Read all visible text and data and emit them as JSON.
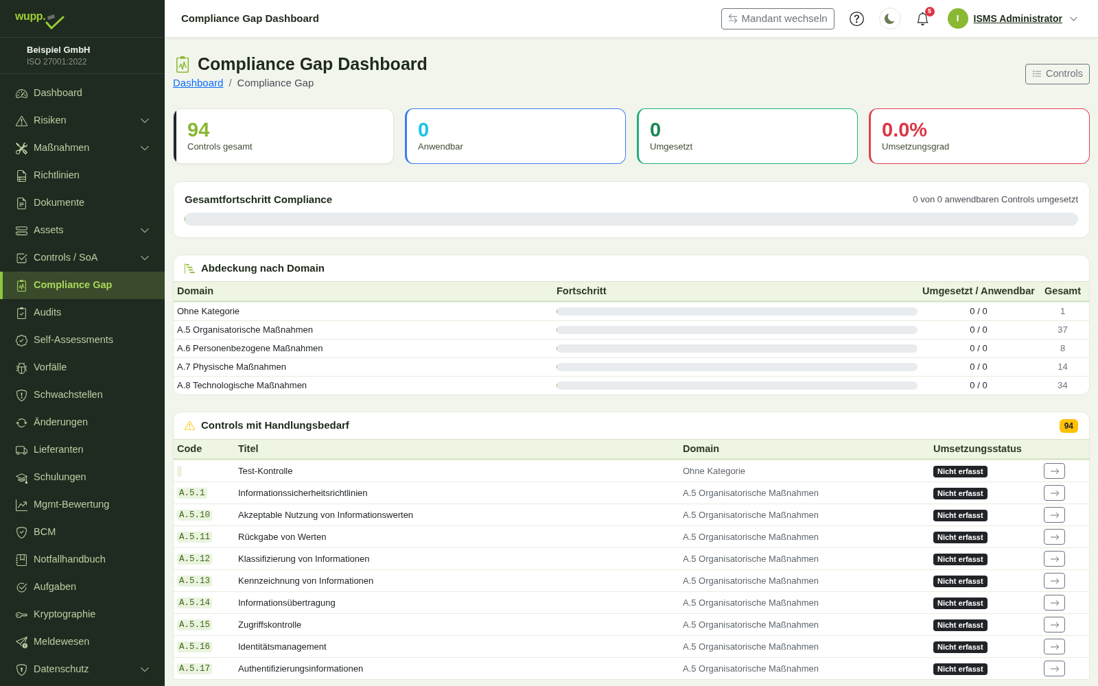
{
  "sidebar": {
    "logo": {
      "text": "wupp."
    },
    "organization": {
      "name": "Beispiel GmbH",
      "standard": "ISO 27001:2022"
    },
    "items": [
      {
        "label": "Dashboard",
        "kind": "link",
        "selected": false
      },
      {
        "label": "Risiken",
        "kind": "group",
        "selected": false,
        "expanded": false
      },
      {
        "label": "Maßnahmen",
        "kind": "group",
        "selected": false,
        "expanded": false
      },
      {
        "label": "Richtlinien",
        "kind": "link",
        "selected": false
      },
      {
        "label": "Dokumente",
        "kind": "link",
        "selected": false
      },
      {
        "label": "Assets",
        "kind": "group",
        "selected": false,
        "expanded": false
      },
      {
        "label": "Controls / SoA",
        "kind": "group",
        "selected": false,
        "expanded": false
      },
      {
        "label": "Compliance Gap",
        "kind": "link",
        "selected": true
      },
      {
        "label": "Audits",
        "kind": "link",
        "selected": false
      },
      {
        "label": "Self-Assessments",
        "kind": "link",
        "selected": false
      },
      {
        "label": "Vorfälle",
        "kind": "link",
        "selected": false
      },
      {
        "label": "Schwachstellen",
        "kind": "link",
        "selected": false
      },
      {
        "label": "Änderungen",
        "kind": "link",
        "selected": false
      },
      {
        "label": "Lieferanten",
        "kind": "link",
        "selected": false
      },
      {
        "label": "Schulungen",
        "kind": "link",
        "selected": false
      },
      {
        "label": "Mgmt-Bewertung",
        "kind": "link",
        "selected": false
      },
      {
        "label": "BCM",
        "kind": "link",
        "selected": false
      },
      {
        "label": "Notfallhandbuch",
        "kind": "link",
        "selected": false
      },
      {
        "label": "Aufgaben",
        "kind": "link",
        "selected": false
      },
      {
        "label": "Kryptographie",
        "kind": "link",
        "selected": false
      },
      {
        "label": "Meldewesen",
        "kind": "link",
        "selected": false
      },
      {
        "label": "Datenschutz",
        "kind": "group",
        "selected": false,
        "expanded": false
      }
    ]
  },
  "header": {
    "title": "Compliance Gap Dashboard",
    "switch_button": "Mandant wechseln",
    "notification_count": "5",
    "user": {
      "initial": "I",
      "name": "ISMS Administrator"
    }
  },
  "page": {
    "title": "Compliance Gap Dashboard",
    "breadcrumb": [
      {
        "label": "Dashboard",
        "current": false
      },
      {
        "label": "Compliance Gap",
        "current": true
      }
    ],
    "breadcrumb_separator": "/",
    "controls_button": "Controls"
  },
  "stats": [
    {
      "value": "94",
      "label": "Controls gesamt",
      "kind": "accent",
      "color": "#8ab833",
      "border": {
        "color": "#212529"
      }
    },
    {
      "value": "0",
      "label": "Anwendbar",
      "kind": "outlined",
      "color": "#19c3e6",
      "border": {
        "color": "#3b7ded"
      }
    },
    {
      "value": "0",
      "label": "Umgesetzt",
      "kind": "outlined",
      "color": "#198754",
      "border": {
        "color": "#22b07d"
      }
    },
    {
      "value": "0.0%",
      "label": "Umsetzungsgrad",
      "kind": "outlined",
      "color": "#dc3545",
      "border": {
        "color": "#e2414f"
      }
    }
  ],
  "overall_progress": {
    "title": "Gesamtfortschritt Compliance",
    "summary": "0 von 0 anwendbaren Controls umgesetzt",
    "level": 0
  },
  "domain_coverage": {
    "title": "Abdeckung nach Domain",
    "columns": [
      "Domain",
      "Fortschritt",
      "Umgesetzt / Anwendbar",
      "Gesamt"
    ],
    "rows": [
      {
        "domain": "Ohne Kategorie",
        "level": 0,
        "ratio": "0 / 0",
        "total": "1"
      },
      {
        "domain": "A.5 Organisatorische Maßnahmen",
        "level": 0,
        "ratio": "0 / 0",
        "total": "37"
      },
      {
        "domain": "A.6 Personenbezogene Maßnahmen",
        "level": 0,
        "ratio": "0 / 0",
        "total": "8"
      },
      {
        "domain": "A.7 Physische Maßnahmen",
        "level": 0,
        "ratio": "0 / 0",
        "total": "14"
      },
      {
        "domain": "A.8 Technologische Maßnahmen",
        "level": 0,
        "ratio": "0 / 0",
        "total": "34"
      }
    ]
  },
  "action_controls": {
    "title": "Controls mit Handlungsbedarf",
    "count": "94",
    "columns": [
      "Code",
      "Titel",
      "Domain",
      "Umsetzungsstatus"
    ],
    "rows": [
      {
        "title": "Test-Kontrolle",
        "domain": "Ohne Kategorie",
        "status": "Nicht erfasst"
      },
      {
        "code": "A.5.1",
        "title": "Informationssicherheitsrichtlinien",
        "domain": "A.5 Organisatorische Maßnahmen",
        "status": "Nicht erfasst"
      },
      {
        "code": "A.5.10",
        "title": "Akzeptable Nutzung von Informationswerten",
        "domain": "A.5 Organisatorische Maßnahmen",
        "status": "Nicht erfasst"
      },
      {
        "code": "A.5.11",
        "title": "Rückgabe von Werten",
        "domain": "A.5 Organisatorische Maßnahmen",
        "status": "Nicht erfasst"
      },
      {
        "code": "A.5.12",
        "title": "Klassifizierung von Informationen",
        "domain": "A.5 Organisatorische Maßnahmen",
        "status": "Nicht erfasst"
      },
      {
        "code": "A.5.13",
        "title": "Kennzeichnung von Informationen",
        "domain": "A.5 Organisatorische Maßnahmen",
        "status": "Nicht erfasst"
      },
      {
        "code": "A.5.14",
        "title": "Informationsübertragung",
        "domain": "A.5 Organisatorische Maßnahmen",
        "status": "Nicht erfasst"
      },
      {
        "code": "A.5.15",
        "title": "Zugriffskontrolle",
        "domain": "A.5 Organisatorische Maßnahmen",
        "status": "Nicht erfasst"
      },
      {
        "code": "A.5.16",
        "title": "Identitätsmanagement",
        "domain": "A.5 Organisatorische Maßnahmen",
        "status": "Nicht erfasst"
      },
      {
        "code": "A.5.17",
        "title": "Authentifizierungsinformationen",
        "domain": "A.5 Organisatorische Maßnahmen",
        "status": "Nicht erfasst"
      }
    ]
  }
}
